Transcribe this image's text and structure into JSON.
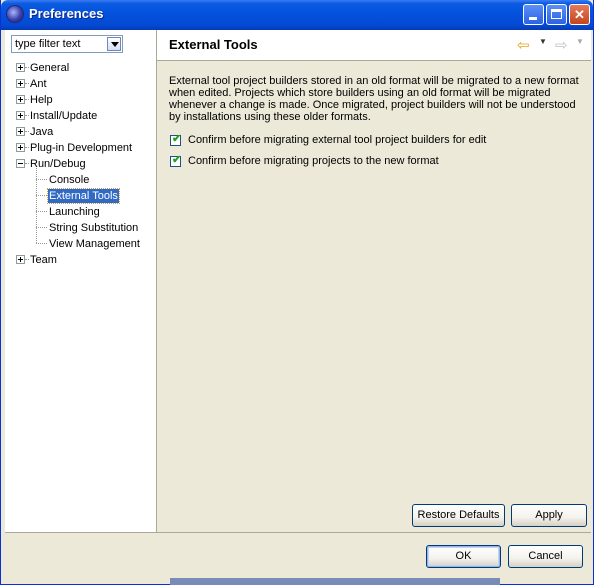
{
  "window": {
    "title": "Preferences",
    "minimize_glyph": "_",
    "maximize_glyph": "□",
    "close_glyph": "✕"
  },
  "filter": {
    "value": "type filter text"
  },
  "tree": {
    "items": [
      {
        "label": "General",
        "expander": "+"
      },
      {
        "label": "Ant",
        "expander": "+"
      },
      {
        "label": "Help",
        "expander": "+"
      },
      {
        "label": "Install/Update",
        "expander": "+"
      },
      {
        "label": "Java",
        "expander": "+"
      },
      {
        "label": "Plug-in Development",
        "expander": "+"
      },
      {
        "label": "Run/Debug",
        "expander": "-"
      },
      {
        "label": "Console",
        "expander": ""
      },
      {
        "label": "External Tools",
        "expander": "",
        "selected": true
      },
      {
        "label": "Launching",
        "expander": ""
      },
      {
        "label": "String Substitution",
        "expander": ""
      },
      {
        "label": "View Management",
        "expander": ""
      },
      {
        "label": "Team",
        "expander": "+"
      }
    ]
  },
  "page": {
    "title": "External Tools",
    "description": "External tool project builders stored in an old format will be migrated to a new format when edited. Projects which store builders using an old format will be migrated whenever a change is made. Once migrated, project builders will not be understood by installations using these older formats.",
    "checkboxes": [
      {
        "label": "Confirm before migrating external tool project builders for edit",
        "checked": true
      },
      {
        "label": "Confirm before migrating projects to the new format",
        "checked": true
      }
    ],
    "restore_defaults_label": "Restore Defaults",
    "apply_label": "Apply"
  },
  "nav": {
    "back_icon": "back-arrow-icon",
    "forward_icon": "forward-arrow-icon"
  },
  "dialog": {
    "ok_label": "OK",
    "cancel_label": "Cancel"
  },
  "colors": {
    "titlebar": "#0553e0",
    "selection": "#316ac5",
    "dialog_bg": "#ece9d8"
  }
}
